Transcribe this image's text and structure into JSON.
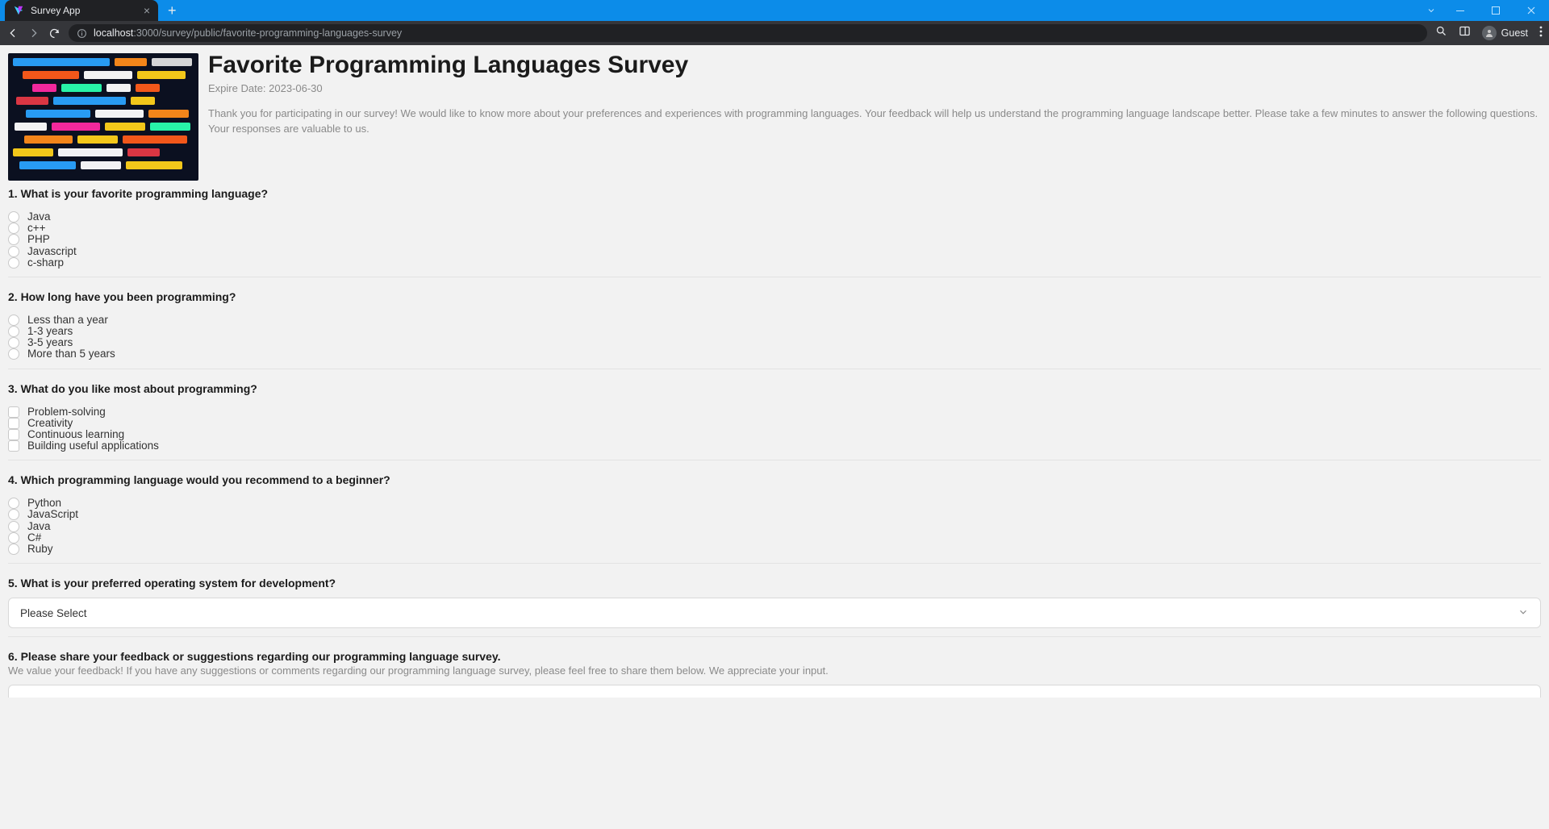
{
  "browser": {
    "tab_title": "Survey App",
    "url_host": "localhost",
    "url_port_path": ":3000/survey/public/favorite-programming-languages-survey",
    "guest_label": "Guest"
  },
  "survey": {
    "title": "Favorite Programming Languages Survey",
    "expire_label": "Expire Date: 2023-06-30",
    "description": "Thank you for participating in our survey! We would like to know more about your preferences and experiences with programming languages. Your feedback will help us understand the programming language landscape better. Please take a few minutes to answer the following questions. Your responses are valuable to us."
  },
  "questions": {
    "q1": {
      "title": "1. What is your favorite programming language?",
      "type": "radio",
      "options": [
        "Java",
        "c++",
        "PHP",
        "Javascript",
        "c-sharp"
      ]
    },
    "q2": {
      "title": "2. How long have you been programming?",
      "type": "radio",
      "options": [
        "Less than a year",
        "1-3 years",
        "3-5 years",
        "More than 5 years"
      ]
    },
    "q3": {
      "title": "3. What do you like most about programming?",
      "type": "checkbox",
      "options": [
        "Problem-solving",
        "Creativity",
        "Continuous learning",
        "Building useful applications"
      ]
    },
    "q4": {
      "title": "4. Which programming language would you recommend to a beginner?",
      "type": "radio",
      "options": [
        "Python",
        "JavaScript",
        "Java",
        "C#",
        "Ruby"
      ]
    },
    "q5": {
      "title": "5. What is your preferred operating system for development?",
      "type": "select",
      "placeholder": "Please Select"
    },
    "q6": {
      "title": "6. Please share your feedback or suggestions regarding our programming language survey.",
      "subtitle": "We value your feedback! If you have any suggestions or comments regarding our programming language survey, please feel free to share them below. We appreciate your input.",
      "type": "textarea"
    }
  }
}
